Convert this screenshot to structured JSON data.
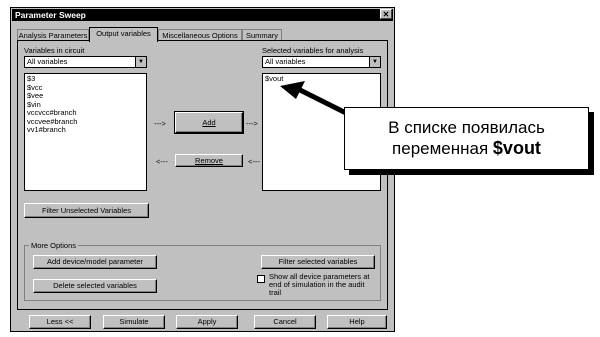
{
  "window": {
    "title": "Parameter Sweep",
    "close": "✕"
  },
  "tabs": [
    {
      "label": "Analysis Parameters"
    },
    {
      "label": "Output variables"
    },
    {
      "label": "Miscellaneous Options"
    },
    {
      "label": "Summary"
    }
  ],
  "left": {
    "label": "Variables in circuit",
    "combo_value": "All variables",
    "items": [
      "$3",
      "$vcc",
      "$vee",
      "$vin",
      "vccvcc#branch",
      "vccvee#branch",
      "vv1#branch"
    ],
    "filter_button": "Filter Unselected Variables"
  },
  "middle": {
    "add_button": "Add",
    "remove_button": "Remove",
    "arrow_right": "--->",
    "arrow_left": "<---"
  },
  "right": {
    "label": "Selected variables for analysis",
    "combo_value": "All variables",
    "items": [
      "$vout"
    ]
  },
  "more_options": {
    "title": "More Options",
    "device_param_button": "Add device/model parameter",
    "delete_button": "Delete selected variables",
    "filter_selected_button": "Filter selected variables",
    "checkbox_label": "Show all device parameters at end of simulation in the audit trail"
  },
  "bottom_buttons": {
    "less": "Less <<",
    "simulate": "Simulate",
    "apply": "Apply",
    "cancel": "Cancel",
    "help": "Help"
  },
  "callout": {
    "line1": "В списке появилась",
    "line2_prefix": "переменная ",
    "line2_bold": "$vout"
  }
}
